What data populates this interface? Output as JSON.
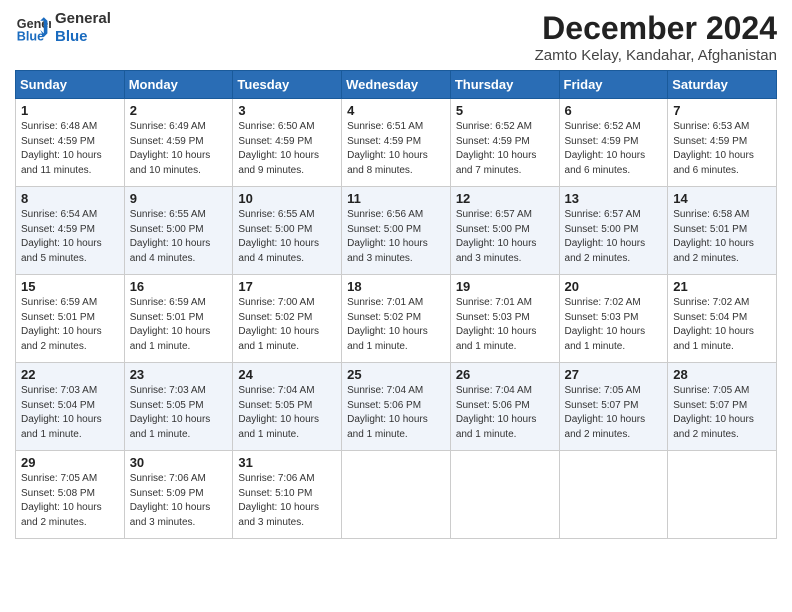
{
  "header": {
    "logo_line1": "General",
    "logo_line2": "Blue",
    "month_title": "December 2024",
    "location": "Zamto Kelay, Kandahar, Afghanistan"
  },
  "days_of_week": [
    "Sunday",
    "Monday",
    "Tuesday",
    "Wednesday",
    "Thursday",
    "Friday",
    "Saturday"
  ],
  "weeks": [
    [
      {
        "day": "1",
        "lines": [
          "Sunrise: 6:48 AM",
          "Sunset: 4:59 PM",
          "Daylight: 10 hours",
          "and 11 minutes."
        ]
      },
      {
        "day": "2",
        "lines": [
          "Sunrise: 6:49 AM",
          "Sunset: 4:59 PM",
          "Daylight: 10 hours",
          "and 10 minutes."
        ]
      },
      {
        "day": "3",
        "lines": [
          "Sunrise: 6:50 AM",
          "Sunset: 4:59 PM",
          "Daylight: 10 hours",
          "and 9 minutes."
        ]
      },
      {
        "day": "4",
        "lines": [
          "Sunrise: 6:51 AM",
          "Sunset: 4:59 PM",
          "Daylight: 10 hours",
          "and 8 minutes."
        ]
      },
      {
        "day": "5",
        "lines": [
          "Sunrise: 6:52 AM",
          "Sunset: 4:59 PM",
          "Daylight: 10 hours",
          "and 7 minutes."
        ]
      },
      {
        "day": "6",
        "lines": [
          "Sunrise: 6:52 AM",
          "Sunset: 4:59 PM",
          "Daylight: 10 hours",
          "and 6 minutes."
        ]
      },
      {
        "day": "7",
        "lines": [
          "Sunrise: 6:53 AM",
          "Sunset: 4:59 PM",
          "Daylight: 10 hours",
          "and 6 minutes."
        ]
      }
    ],
    [
      {
        "day": "8",
        "lines": [
          "Sunrise: 6:54 AM",
          "Sunset: 4:59 PM",
          "Daylight: 10 hours",
          "and 5 minutes."
        ]
      },
      {
        "day": "9",
        "lines": [
          "Sunrise: 6:55 AM",
          "Sunset: 5:00 PM",
          "Daylight: 10 hours",
          "and 4 minutes."
        ]
      },
      {
        "day": "10",
        "lines": [
          "Sunrise: 6:55 AM",
          "Sunset: 5:00 PM",
          "Daylight: 10 hours",
          "and 4 minutes."
        ]
      },
      {
        "day": "11",
        "lines": [
          "Sunrise: 6:56 AM",
          "Sunset: 5:00 PM",
          "Daylight: 10 hours",
          "and 3 minutes."
        ]
      },
      {
        "day": "12",
        "lines": [
          "Sunrise: 6:57 AM",
          "Sunset: 5:00 PM",
          "Daylight: 10 hours",
          "and 3 minutes."
        ]
      },
      {
        "day": "13",
        "lines": [
          "Sunrise: 6:57 AM",
          "Sunset: 5:00 PM",
          "Daylight: 10 hours",
          "and 2 minutes."
        ]
      },
      {
        "day": "14",
        "lines": [
          "Sunrise: 6:58 AM",
          "Sunset: 5:01 PM",
          "Daylight: 10 hours",
          "and 2 minutes."
        ]
      }
    ],
    [
      {
        "day": "15",
        "lines": [
          "Sunrise: 6:59 AM",
          "Sunset: 5:01 PM",
          "Daylight: 10 hours",
          "and 2 minutes."
        ]
      },
      {
        "day": "16",
        "lines": [
          "Sunrise: 6:59 AM",
          "Sunset: 5:01 PM",
          "Daylight: 10 hours",
          "and 1 minute."
        ]
      },
      {
        "day": "17",
        "lines": [
          "Sunrise: 7:00 AM",
          "Sunset: 5:02 PM",
          "Daylight: 10 hours",
          "and 1 minute."
        ]
      },
      {
        "day": "18",
        "lines": [
          "Sunrise: 7:01 AM",
          "Sunset: 5:02 PM",
          "Daylight: 10 hours",
          "and 1 minute."
        ]
      },
      {
        "day": "19",
        "lines": [
          "Sunrise: 7:01 AM",
          "Sunset: 5:03 PM",
          "Daylight: 10 hours",
          "and 1 minute."
        ]
      },
      {
        "day": "20",
        "lines": [
          "Sunrise: 7:02 AM",
          "Sunset: 5:03 PM",
          "Daylight: 10 hours",
          "and 1 minute."
        ]
      },
      {
        "day": "21",
        "lines": [
          "Sunrise: 7:02 AM",
          "Sunset: 5:04 PM",
          "Daylight: 10 hours",
          "and 1 minute."
        ]
      }
    ],
    [
      {
        "day": "22",
        "lines": [
          "Sunrise: 7:03 AM",
          "Sunset: 5:04 PM",
          "Daylight: 10 hours",
          "and 1 minute."
        ]
      },
      {
        "day": "23",
        "lines": [
          "Sunrise: 7:03 AM",
          "Sunset: 5:05 PM",
          "Daylight: 10 hours",
          "and 1 minute."
        ]
      },
      {
        "day": "24",
        "lines": [
          "Sunrise: 7:04 AM",
          "Sunset: 5:05 PM",
          "Daylight: 10 hours",
          "and 1 minute."
        ]
      },
      {
        "day": "25",
        "lines": [
          "Sunrise: 7:04 AM",
          "Sunset: 5:06 PM",
          "Daylight: 10 hours",
          "and 1 minute."
        ]
      },
      {
        "day": "26",
        "lines": [
          "Sunrise: 7:04 AM",
          "Sunset: 5:06 PM",
          "Daylight: 10 hours",
          "and 1 minute."
        ]
      },
      {
        "day": "27",
        "lines": [
          "Sunrise: 7:05 AM",
          "Sunset: 5:07 PM",
          "Daylight: 10 hours",
          "and 2 minutes."
        ]
      },
      {
        "day": "28",
        "lines": [
          "Sunrise: 7:05 AM",
          "Sunset: 5:07 PM",
          "Daylight: 10 hours",
          "and 2 minutes."
        ]
      }
    ],
    [
      {
        "day": "29",
        "lines": [
          "Sunrise: 7:05 AM",
          "Sunset: 5:08 PM",
          "Daylight: 10 hours",
          "and 2 minutes."
        ]
      },
      {
        "day": "30",
        "lines": [
          "Sunrise: 7:06 AM",
          "Sunset: 5:09 PM",
          "Daylight: 10 hours",
          "and 3 minutes."
        ]
      },
      {
        "day": "31",
        "lines": [
          "Sunrise: 7:06 AM",
          "Sunset: 5:10 PM",
          "Daylight: 10 hours",
          "and 3 minutes."
        ]
      },
      null,
      null,
      null,
      null
    ]
  ]
}
